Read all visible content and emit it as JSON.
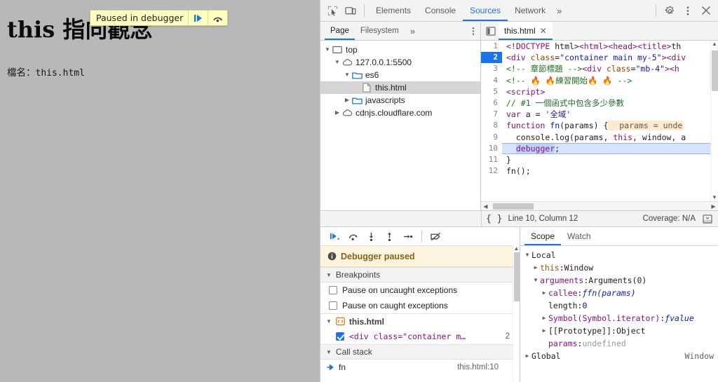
{
  "page": {
    "title": "this 指向觀念",
    "filename_label": "檔名：",
    "filename_value": "this.html",
    "paused_overlay": {
      "text": "Paused in debugger",
      "resume_icon": "resume-script-icon",
      "step_icon": "step-over-icon"
    }
  },
  "devtools": {
    "toolbar": {
      "inspect_icon": "inspect-element-icon",
      "device_icon": "device-toolbar-icon",
      "tabs": [
        {
          "label": "Elements",
          "active": false
        },
        {
          "label": "Console",
          "active": false
        },
        {
          "label": "Sources",
          "active": true
        },
        {
          "label": "Network",
          "active": false
        }
      ],
      "more_tabs_label": "»",
      "settings_icon": "gear-icon",
      "menu_icon": "kebab-menu-icon",
      "close_icon": "close-icon"
    },
    "navigator": {
      "tabs": [
        {
          "label": "Page",
          "active": true
        },
        {
          "label": "Filesystem",
          "active": false
        }
      ],
      "more_label": "»",
      "menu_icon": "kebab-menu-icon",
      "tree": [
        {
          "label": "top",
          "icon": "frame-icon",
          "twisty": "open",
          "indent": 0,
          "selected": false
        },
        {
          "label": "127.0.0.1:5500",
          "icon": "cloud-icon",
          "twisty": "open",
          "indent": 1,
          "selected": false
        },
        {
          "label": "es6",
          "icon": "folder-icon",
          "twisty": "open",
          "indent": 2,
          "selected": false
        },
        {
          "label": "this.html",
          "icon": "file-icon",
          "twisty": "none",
          "indent": 3,
          "selected": true
        },
        {
          "label": "javascripts",
          "icon": "folder-icon",
          "twisty": "closed",
          "indent": 2,
          "selected": false
        },
        {
          "label": "cdnjs.cloudflare.com",
          "icon": "cloud-icon",
          "twisty": "closed",
          "indent": 1,
          "selected": false
        }
      ]
    },
    "editor": {
      "panel_icon": "show-navigator-icon",
      "tab_label": "this.html",
      "tab_close_icon": "close-icon",
      "lines": [
        {
          "n": "1",
          "state": "",
          "tokens": [
            {
              "t": "<!DOCTYPE",
              "c": "tok-tag"
            },
            {
              "t": " html>",
              "c": "tok-plain"
            },
            {
              "t": "<html>",
              "c": "tok-tag"
            },
            {
              "t": "<head>",
              "c": "tok-tag"
            },
            {
              "t": "<title>",
              "c": "tok-tag"
            },
            {
              "t": "th",
              "c": "tok-plain"
            }
          ]
        },
        {
          "n": "2",
          "state": "bp",
          "tokens": [
            {
              "t": "<div ",
              "c": "tok-tag"
            },
            {
              "t": "class",
              "c": "tok-attr"
            },
            {
              "t": "=",
              "c": "tok-plain"
            },
            {
              "t": "\"container main my-5\"",
              "c": "tok-str"
            },
            {
              "t": "><div",
              "c": "tok-tag"
            }
          ]
        },
        {
          "n": "3",
          "state": "",
          "tokens": [
            {
              "t": "<!-- 章節標題 -->",
              "c": "tok-com"
            },
            {
              "t": "<div ",
              "c": "tok-tag"
            },
            {
              "t": "class",
              "c": "tok-attr"
            },
            {
              "t": "=",
              "c": "tok-plain"
            },
            {
              "t": "\"mb-4\"",
              "c": "tok-str"
            },
            {
              "t": "><h",
              "c": "tok-tag"
            }
          ]
        },
        {
          "n": "4",
          "state": "",
          "tokens": [
            {
              "t": "<!-- ",
              "c": "tok-com"
            },
            {
              "t": "🔥 🔥",
              "c": "flame"
            },
            {
              "t": "練習開始",
              "c": "tok-com"
            },
            {
              "t": "🔥 🔥",
              "c": "flame"
            },
            {
              "t": " -->",
              "c": "tok-com"
            }
          ]
        },
        {
          "n": "5",
          "state": "",
          "tokens": [
            {
              "t": "<script>",
              "c": "tok-tag"
            }
          ]
        },
        {
          "n": "6",
          "state": "",
          "tokens": [
            {
              "t": "// #1 一個函式中包含多少參數",
              "c": "tok-com"
            }
          ]
        },
        {
          "n": "7",
          "state": "",
          "tokens": [
            {
              "t": "var",
              "c": "tok-kw"
            },
            {
              "t": " a ",
              "c": "tok-plain"
            },
            {
              "t": "=",
              "c": "tok-plain"
            },
            {
              "t": " ",
              "c": "tok-plain"
            },
            {
              "t": "'全域'",
              "c": "tok-str"
            }
          ]
        },
        {
          "n": "8",
          "state": "",
          "tokens": [
            {
              "t": "function",
              "c": "tok-kw"
            },
            {
              "t": " ",
              "c": "tok-plain"
            },
            {
              "t": "fn",
              "c": "tok-var"
            },
            {
              "t": "(params) {",
              "c": "tok-plain"
            }
          ],
          "hint": "  params = unde"
        },
        {
          "n": "9",
          "state": "",
          "tokens": [
            {
              "t": "  console",
              "c": "tok-plain"
            },
            {
              "t": ".",
              "c": "tok-plain"
            },
            {
              "t": "log",
              "c": "tok-plain"
            },
            {
              "t": "(params, ",
              "c": "tok-plain"
            },
            {
              "t": "this",
              "c": "tok-kw"
            },
            {
              "t": ", window, a",
              "c": "tok-plain"
            }
          ]
        },
        {
          "n": "10",
          "state": "paused",
          "tokens": [
            {
              "t": "  ",
              "c": "tok-plain"
            },
            {
              "t": "debugger",
              "c": "tok-kw sel-word"
            },
            {
              "t": ";",
              "c": "tok-plain"
            }
          ]
        },
        {
          "n": "11",
          "state": "",
          "tokens": [
            {
              "t": "}",
              "c": "tok-plain"
            }
          ]
        },
        {
          "n": "12",
          "state": "",
          "tokens": [
            {
              "t": "fn();",
              "c": "tok-plain"
            }
          ]
        }
      ],
      "status": {
        "format_icon": "pretty-print-icon",
        "position": "Line 10, Column 12",
        "coverage": "Coverage: N/A",
        "drawer_icon": "show-drawer-icon"
      }
    },
    "debugger": {
      "toolbar_buttons": [
        {
          "icon": "resume-script-icon",
          "name": "resume-button"
        },
        {
          "icon": "step-over-icon",
          "name": "step-over-button"
        },
        {
          "icon": "step-into-icon",
          "name": "step-into-button"
        },
        {
          "icon": "step-out-icon",
          "name": "step-out-button"
        },
        {
          "icon": "step-icon",
          "name": "step-button"
        },
        {
          "icon": "deactivate-breakpoints-icon",
          "name": "deactivate-breakpoints-button"
        }
      ],
      "paused_message": "Debugger paused",
      "paused_info_icon": "info-icon",
      "breakpoints": {
        "header": "Breakpoints",
        "options": [
          {
            "label": "Pause on uncaught exceptions",
            "checked": false
          },
          {
            "label": "Pause on caught exceptions",
            "checked": false
          }
        ],
        "file": "this.html",
        "file_icon": "html-file-icon",
        "entries": [
          {
            "checked": true,
            "code": "<div class=\"container m…",
            "line": "2"
          }
        ]
      },
      "call_stack": {
        "header": "Call stack",
        "frames": [
          {
            "selected": true,
            "name": "fn",
            "location": "this.html:10",
            "icon": "current-frame-icon"
          }
        ]
      }
    },
    "scope": {
      "tabs": [
        {
          "label": "Scope",
          "active": true
        },
        {
          "label": "Watch",
          "active": false
        }
      ],
      "rows": [
        {
          "indent": 0,
          "twisty": "open",
          "parts": [
            {
              "t": "Local",
              "c": "k-plain"
            }
          ]
        },
        {
          "indent": 1,
          "twisty": "closed",
          "parts": [
            {
              "t": "this",
              "c": "k-this"
            },
            {
              "t": ": ",
              "c": "k-plain"
            },
            {
              "t": "Window",
              "c": "k-plain"
            }
          ]
        },
        {
          "indent": 1,
          "twisty": "open",
          "parts": [
            {
              "t": "arguments",
              "c": "k-name"
            },
            {
              "t": ": ",
              "c": "k-plain"
            },
            {
              "t": "Arguments(0)",
              "c": "k-plain"
            }
          ]
        },
        {
          "indent": 2,
          "twisty": "closed",
          "parts": [
            {
              "t": "callee",
              "c": "k-name"
            },
            {
              "t": ": ",
              "c": "k-plain"
            },
            {
              "t": "ƒ ",
              "c": "k-fn"
            },
            {
              "t": "fn(params)",
              "c": "k-fn"
            }
          ]
        },
        {
          "indent": 2,
          "twisty": "none",
          "parts": [
            {
              "t": "length",
              "c": "k-plain"
            },
            {
              "t": ": ",
              "c": "k-plain"
            },
            {
              "t": "0",
              "c": "k-num"
            }
          ]
        },
        {
          "indent": 2,
          "twisty": "closed",
          "parts": [
            {
              "t": "Symbol(Symbol.iterator)",
              "c": "k-name"
            },
            {
              "t": ": ",
              "c": "k-plain"
            },
            {
              "t": "ƒ ",
              "c": "k-fn"
            },
            {
              "t": "value",
              "c": "k-fn"
            }
          ]
        },
        {
          "indent": 2,
          "twisty": "closed",
          "parts": [
            {
              "t": "[[Prototype]]",
              "c": "k-plain"
            },
            {
              "t": ": ",
              "c": "k-plain"
            },
            {
              "t": "Object",
              "c": "k-plain"
            }
          ]
        },
        {
          "indent": 2,
          "twisty": "none",
          "parts": [
            {
              "t": "params",
              "c": "k-name"
            },
            {
              "t": ": ",
              "c": "k-plain"
            },
            {
              "t": "undefined",
              "c": "k-undef"
            }
          ]
        },
        {
          "indent": 0,
          "twisty": "closed",
          "parts": [
            {
              "t": "Global",
              "c": "k-plain"
            }
          ],
          "right": "Window"
        }
      ]
    }
  },
  "colors": {
    "accent": "#1a73e8",
    "paused_banner_bg": "#ffffc2",
    "paused_msg_bg": "#fdf4dd",
    "paused_line_bg": "#d6e4fb",
    "hint_bg": "#ffe9cf"
  }
}
